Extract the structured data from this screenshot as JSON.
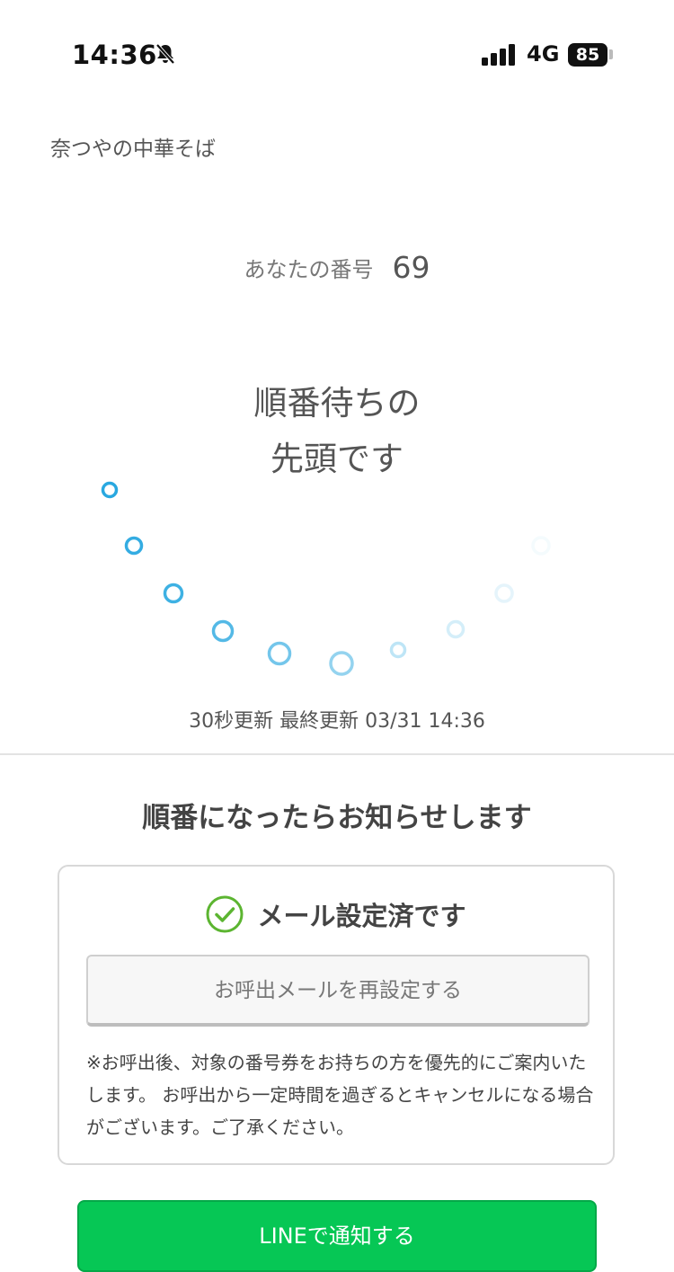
{
  "status_bar": {
    "time": "14:36",
    "network": "4G",
    "battery": "85"
  },
  "shop": {
    "name": "奈つやの中華そば"
  },
  "ticket": {
    "label": "あなたの番号",
    "number": "69"
  },
  "queue": {
    "status_line1": "順番待ちの",
    "status_line2": "先頭です"
  },
  "update": {
    "text": "30秒更新 最終更新 03/31 14:36"
  },
  "notify": {
    "title": "順番になったらお知らせします",
    "mail_status": "メール設定済です",
    "reset_button": "お呼出メールを再設定する",
    "note": "※お呼出後、対象の番号券をお持ちの方を優先的にご案内いたします。 お呼出から一定時間を過ぎるとキャンセルになる場合がございます。ご了承ください。",
    "line_button": "LINEで通知する"
  },
  "colors": {
    "spinner": "#29a8e0",
    "check": "#5cb531",
    "line_green": "#06c755"
  },
  "icons": [
    "bell-slash-icon",
    "signal-icon",
    "battery-icon",
    "check-circle-icon",
    "loading-spinner-icon"
  ]
}
